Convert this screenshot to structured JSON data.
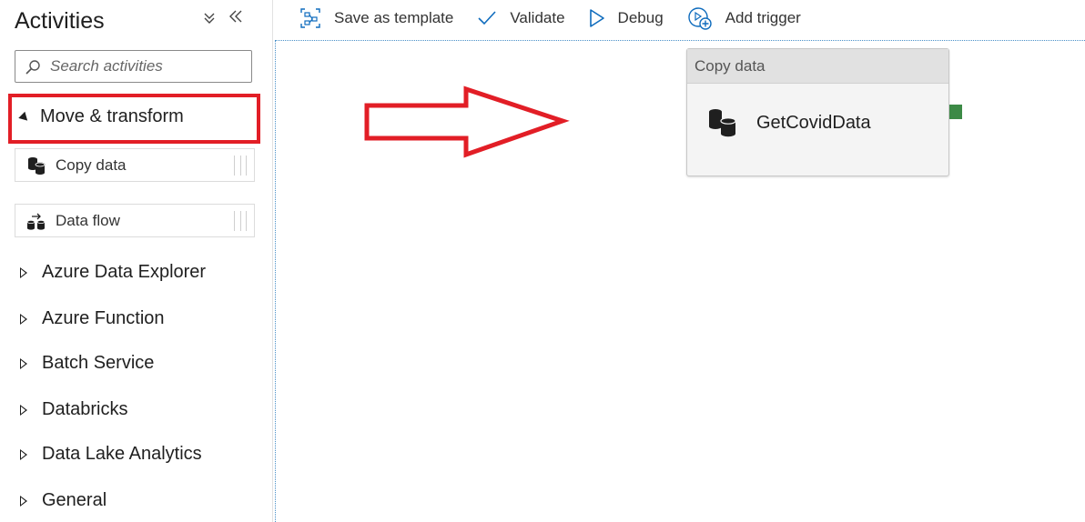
{
  "sidebar": {
    "title": "Activities",
    "search_placeholder": "Search activities",
    "expanded_category": "Move & transform",
    "activities": [
      {
        "label": "Copy data",
        "icon": "copy-data-icon"
      },
      {
        "label": "Data flow",
        "icon": "data-flow-icon"
      }
    ],
    "categories": [
      {
        "label": "Azure Data Explorer"
      },
      {
        "label": "Azure Function"
      },
      {
        "label": "Batch Service"
      },
      {
        "label": "Databricks"
      },
      {
        "label": "Data Lake Analytics"
      },
      {
        "label": "General"
      }
    ]
  },
  "toolbar": {
    "save_template": "Save as template",
    "validate": "Validate",
    "debug": "Debug",
    "add_trigger": "Add trigger"
  },
  "canvas": {
    "node": {
      "type_label": "Copy data",
      "name": "GetCovidData"
    }
  },
  "colors": {
    "highlight": "#e21e26",
    "accent": "#0f6cbd",
    "success_port": "#3c8a46"
  }
}
